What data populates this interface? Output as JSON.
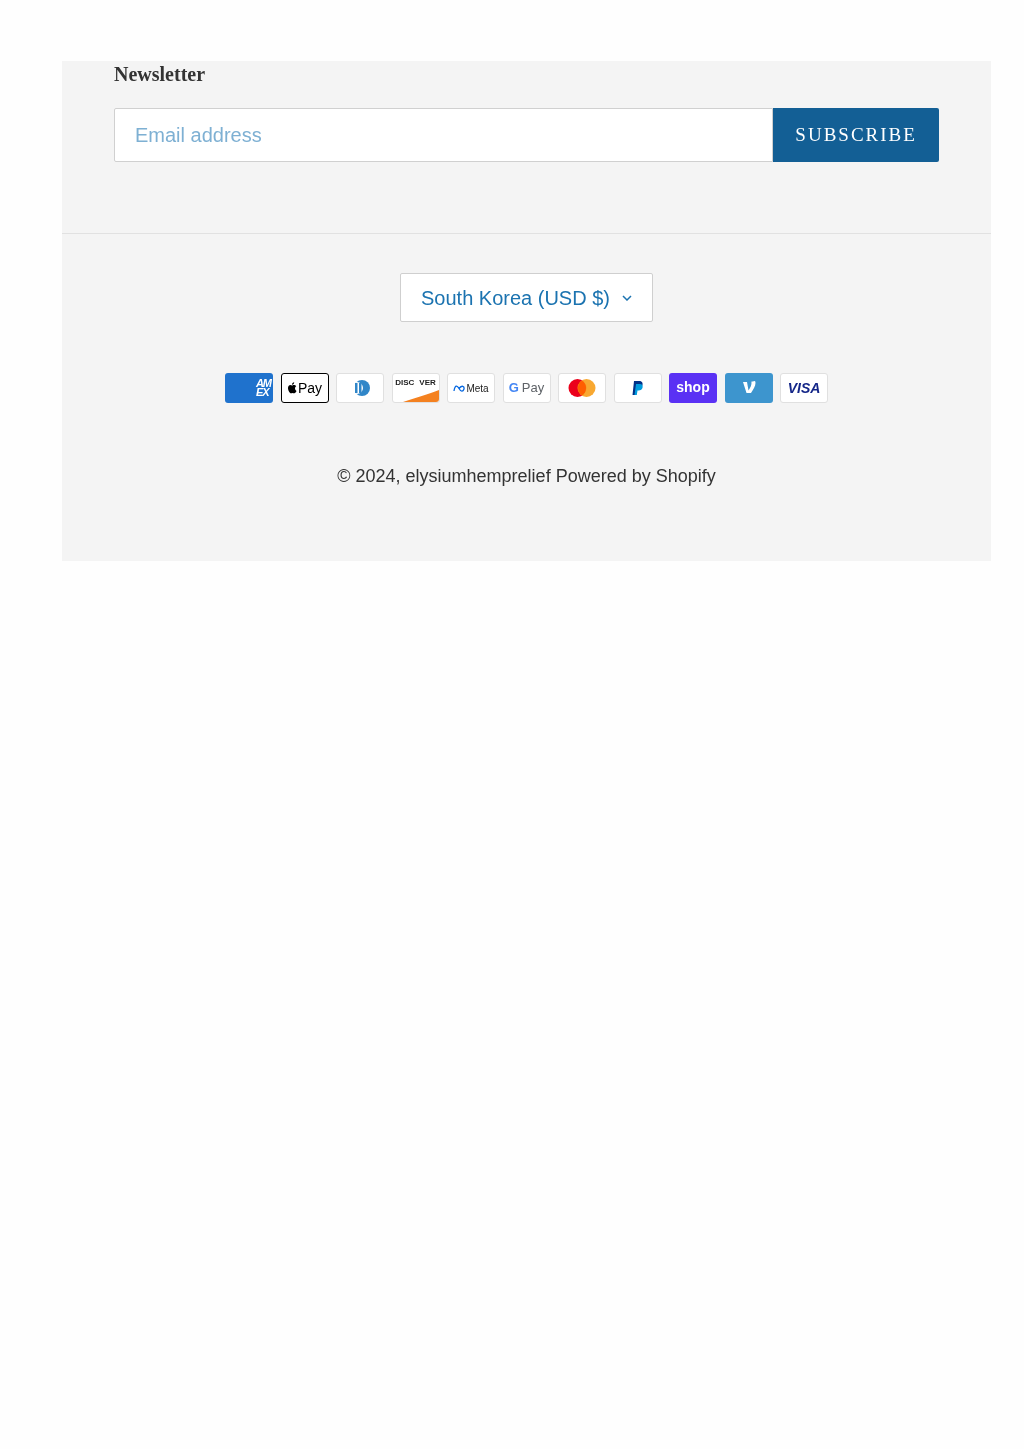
{
  "newsletter": {
    "heading": "Newsletter",
    "email": {
      "placeholder": "Email address"
    },
    "button": "SUBSCRIBE"
  },
  "currency_selector": {
    "value": "South Korea (USD $)"
  },
  "payment_methods": [
    {
      "kind": "amex",
      "lines": [
        "AM",
        "EX"
      ]
    },
    {
      "kind": "applepay",
      "lines": [
        "Pay"
      ]
    },
    {
      "kind": "diners"
    },
    {
      "kind": "discover",
      "lines": [
        "DISC",
        "VER"
      ]
    },
    {
      "kind": "meta",
      "lines": [
        "Meta"
      ]
    },
    {
      "kind": "googlepay",
      "lines": [
        "G",
        "Pay"
      ]
    },
    {
      "kind": "mastercard"
    },
    {
      "kind": "paypal"
    },
    {
      "kind": "shoppay",
      "lines": [
        "shop"
      ]
    },
    {
      "kind": "venmo"
    },
    {
      "kind": "visa",
      "lines": [
        "VISA"
      ]
    }
  ],
  "copyright": "© 2024, elysiumhemprelief Powered by Shopify"
}
